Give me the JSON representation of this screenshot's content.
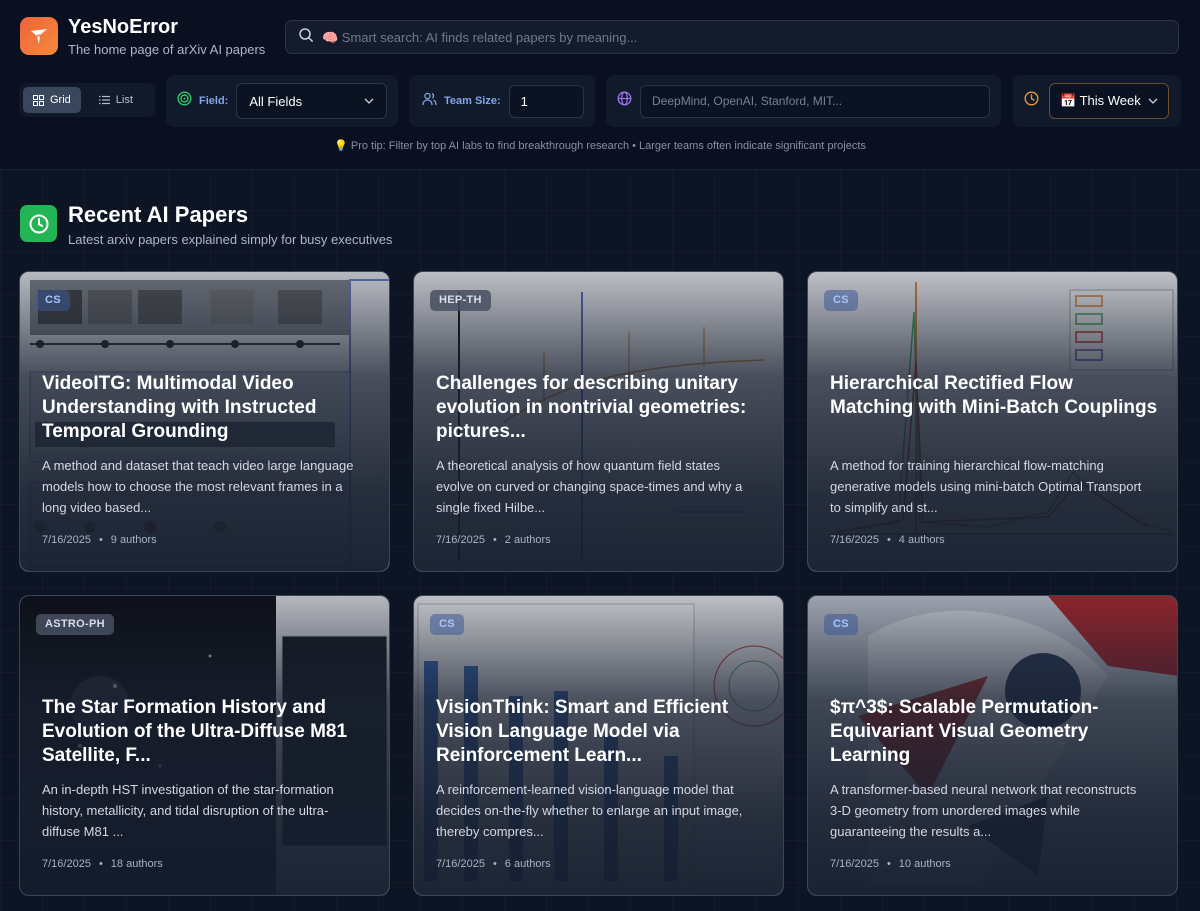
{
  "brand": {
    "title": "YesNoError",
    "subtitle": "The home page of arXiv AI papers"
  },
  "search": {
    "placeholder": "🧠 Smart search: AI finds related papers by meaning..."
  },
  "view_toggle": {
    "grid_label": "Grid",
    "list_label": "List",
    "active": "Grid"
  },
  "filters": {
    "field": {
      "label": "Field:",
      "value": "All Fields"
    },
    "team_size": {
      "label": "Team Size:",
      "value": "1"
    },
    "organization": {
      "placeholder": "DeepMind, OpenAI, Stanford, MIT..."
    },
    "time": {
      "value": "📅 This Week"
    }
  },
  "protip": "💡 Pro tip: Filter by top AI labs to find breakthrough research • Larger teams often indicate significant projects",
  "section": {
    "title": "Recent AI Papers",
    "subtitle": "Latest arxiv papers explained simply for busy executives"
  },
  "papers": [
    {
      "tag": "CS",
      "title": "VideoITG: Multimodal Video Understanding with Instructed Temporal Grounding",
      "description": "A method and dataset that teach video large language models how to choose the most relevant frames in a long video based...",
      "date": "7/16/2025",
      "authors": "9 authors"
    },
    {
      "tag": "HEP-TH",
      "title": "Challenges for describing unitary evolution in nontrivial geometries: pictures...",
      "description": "A theoretical analysis of how quantum field states evolve on curved or changing space-times and why a single fixed Hilbe...",
      "date": "7/16/2025",
      "authors": "2 authors"
    },
    {
      "tag": "CS",
      "title": "Hierarchical Rectified Flow Matching with Mini-Batch Couplings",
      "description": "A method for training hierarchical flow-matching generative models using mini-batch Optimal Transport to simplify and st...",
      "date": "7/16/2025",
      "authors": "4 authors"
    },
    {
      "tag": "ASTRO-PH",
      "title": "The Star Formation History and Evolution of the Ultra-Diffuse M81 Satellite, F...",
      "description": "An in-depth HST investigation of the star-formation history, metallicity, and tidal disruption of the ultra-diffuse M81 ...",
      "date": "7/16/2025",
      "authors": "18 authors"
    },
    {
      "tag": "CS",
      "title": "VisionThink: Smart and Efficient Vision Language Model via Reinforcement Learn...",
      "description": "A reinforcement-learned vision-language model that decides on-the-fly whether to enlarge an input image, thereby compres...",
      "date": "7/16/2025",
      "authors": "6 authors"
    },
    {
      "tag": "CS",
      "title": "$π^3$: Scalable Permutation-Equivariant Visual Geometry Learning",
      "description": "A transformer-based neural network that reconstructs 3-D geometry from unordered images while guaranteeing the results a...",
      "date": "7/16/2025",
      "authors": "10 authors"
    }
  ],
  "colors": {
    "brand": "#f0633a",
    "section_icon": "#23b455",
    "accent_blue": "#7fa6e8"
  }
}
